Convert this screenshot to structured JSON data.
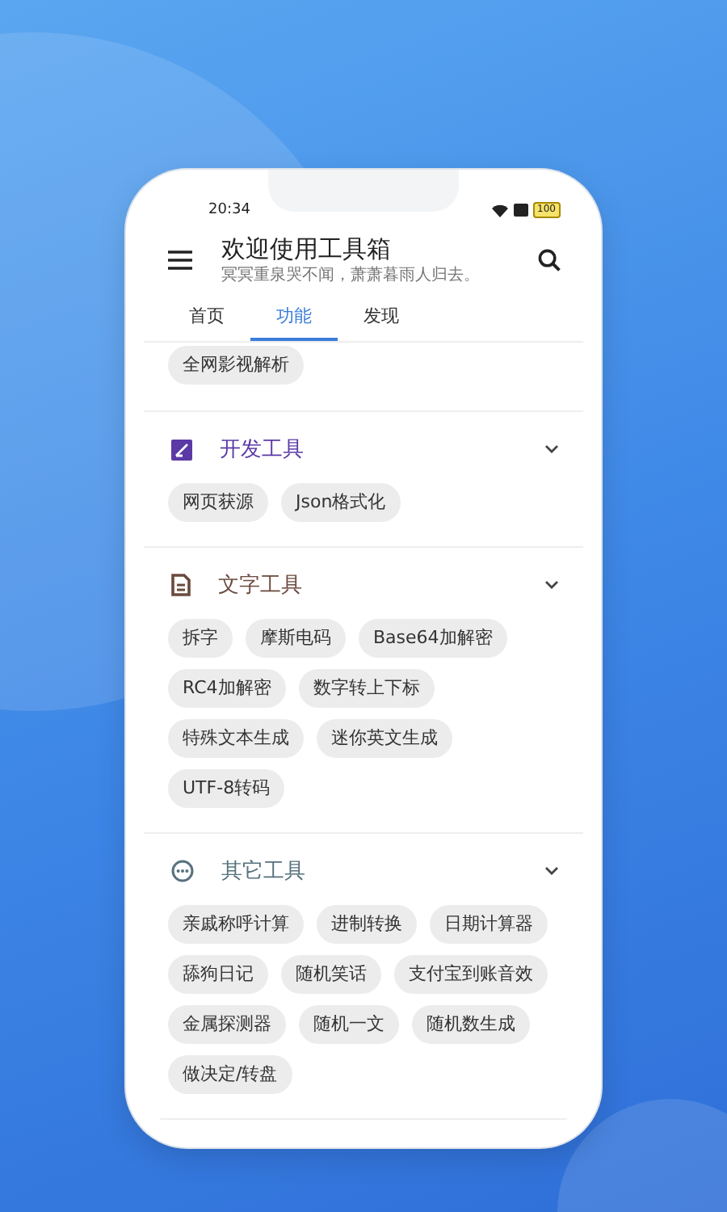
{
  "status_bar": {
    "time": "20:34",
    "battery": "100"
  },
  "header": {
    "title": "欢迎使用工具箱",
    "subtitle": "冥冥重泉哭不闻，萧萧暮雨人归去。"
  },
  "tabs": [
    {
      "label": "首页",
      "selected": false
    },
    {
      "label": "功能",
      "selected": true
    },
    {
      "label": "发现",
      "selected": false
    }
  ],
  "top_chips": [
    "全网影视解析"
  ],
  "sections": [
    {
      "title": "开发工具",
      "kind": "dev",
      "color": "#5b3aa6",
      "expanded": true,
      "chips": [
        "网页获源",
        "Json格式化"
      ]
    },
    {
      "title": "文字工具",
      "kind": "text",
      "color": "#6b4a3e",
      "expanded": true,
      "chips": [
        "拆字",
        "摩斯电码",
        "Base64加解密",
        "RC4加解密",
        "数字转上下标",
        "特殊文本生成",
        "迷你英文生成",
        "UTF-8转码"
      ]
    },
    {
      "title": "其它工具",
      "kind": "other",
      "color": "#56717e",
      "expanded": true,
      "chips": [
        "亲戚称呼计算",
        "进制转换",
        "日期计算器",
        "舔狗日记",
        "随机笑话",
        "支付宝到账音效",
        "金属探测器",
        "随机一文",
        "随机数生成",
        "做决定/转盘"
      ]
    }
  ]
}
